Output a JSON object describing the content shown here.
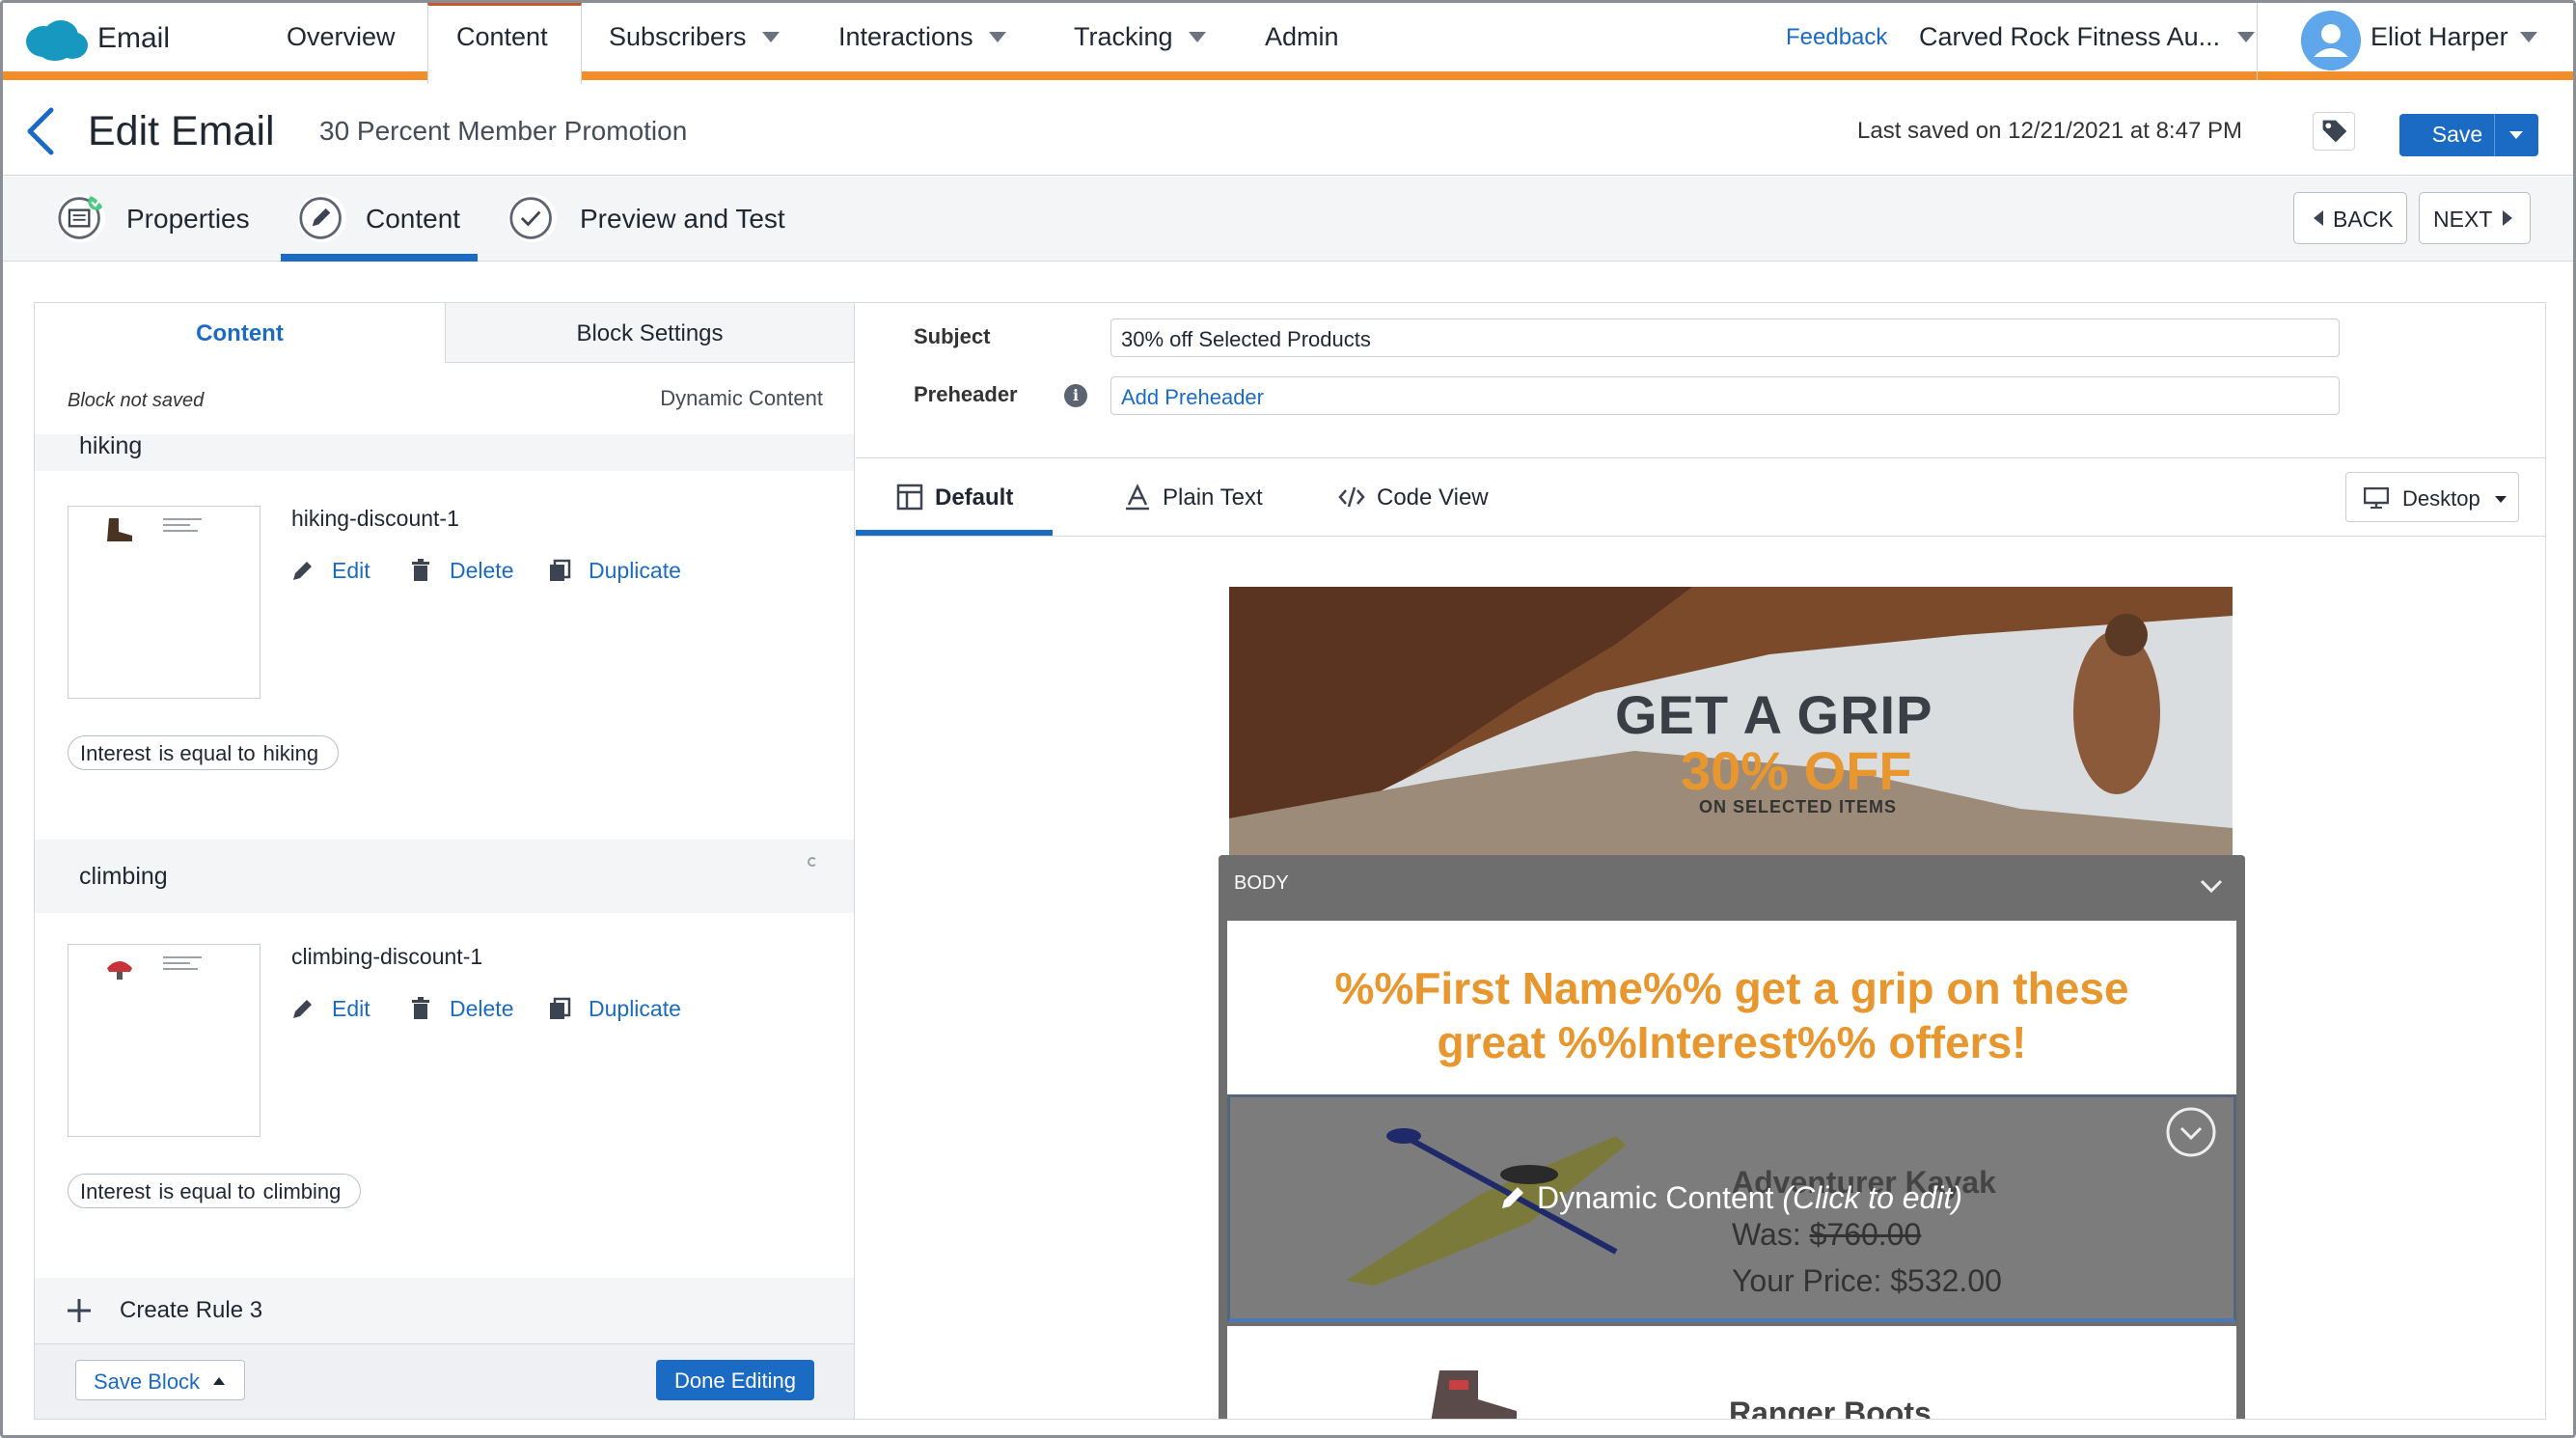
{
  "app": {
    "name": "Email"
  },
  "nav": {
    "items": [
      {
        "label": "Overview",
        "dropdown": false
      },
      {
        "label": "Content",
        "dropdown": false,
        "active": true
      },
      {
        "label": "Subscribers",
        "dropdown": true
      },
      {
        "label": "Interactions",
        "dropdown": true
      },
      {
        "label": "Tracking",
        "dropdown": true
      },
      {
        "label": "Admin",
        "dropdown": false
      }
    ],
    "feedback": "Feedback",
    "org": "Carved Rock Fitness Au...",
    "user": "Eliot Harper"
  },
  "header": {
    "title": "Edit Email",
    "email_name": "30 Percent Member Promotion",
    "last_saved": "Last saved on 12/21/2021 at 8:47 PM",
    "save_label": "Save"
  },
  "steps": {
    "items": [
      {
        "label": "Properties",
        "completed": true
      },
      {
        "label": "Content",
        "active": true
      },
      {
        "label": "Preview and Test"
      }
    ],
    "back_label": "BACK",
    "next_label": "NEXT"
  },
  "left_panel": {
    "tabs": {
      "content": "Content",
      "block_settings": "Block Settings"
    },
    "block_status": "Block not saved",
    "block_type": "Dynamic Content",
    "rules": [
      {
        "name": "hiking",
        "variant": "hiking-discount-1",
        "condition": {
          "field": "Interest",
          "operator": "is equal to",
          "value": "hiking"
        }
      },
      {
        "name": "climbing",
        "variant": "climbing-discount-1",
        "condition": {
          "field": "Interest",
          "operator": "is equal to",
          "value": "climbing"
        }
      }
    ],
    "actions": {
      "edit": "Edit",
      "delete": "Delete",
      "duplicate": "Duplicate"
    },
    "create_rule": "Create Rule 3",
    "save_block": "Save Block",
    "done_editing": "Done Editing"
  },
  "right_panel": {
    "subject_label": "Subject",
    "subject_value": "30% off Selected Products",
    "preheader_label": "Preheader",
    "preheader_placeholder": "Add Preheader",
    "editor_tabs": [
      {
        "label": "Default",
        "active": true,
        "icon": "layout-icon"
      },
      {
        "label": "Plain Text",
        "icon": "text-icon"
      },
      {
        "label": "Code View",
        "icon": "code-icon"
      }
    ],
    "device": "Desktop"
  },
  "email_preview": {
    "hero": {
      "title": "GET A GRIP",
      "offer": "30% OFF",
      "subtitle": "ON SELECTED ITEMS"
    },
    "body_label": "BODY",
    "greeting_line1": "%%First Name%% get a grip on these",
    "greeting_line2": "great %%Interest%% offers!",
    "dynamic_overlay": "Dynamic Content",
    "dynamic_overlay_hint": "(Click to edit)",
    "product": {
      "name": "Adventurer Kayak",
      "was_label": "Was:",
      "was_price": "$760.00",
      "price_label": "Your Price:",
      "price": "$532.00"
    },
    "next_product": {
      "name": "Ranger Boots"
    }
  },
  "colors": {
    "accent": "#1b6bc4",
    "nav_border": "#f18e2a",
    "offer": "#e8962e"
  }
}
